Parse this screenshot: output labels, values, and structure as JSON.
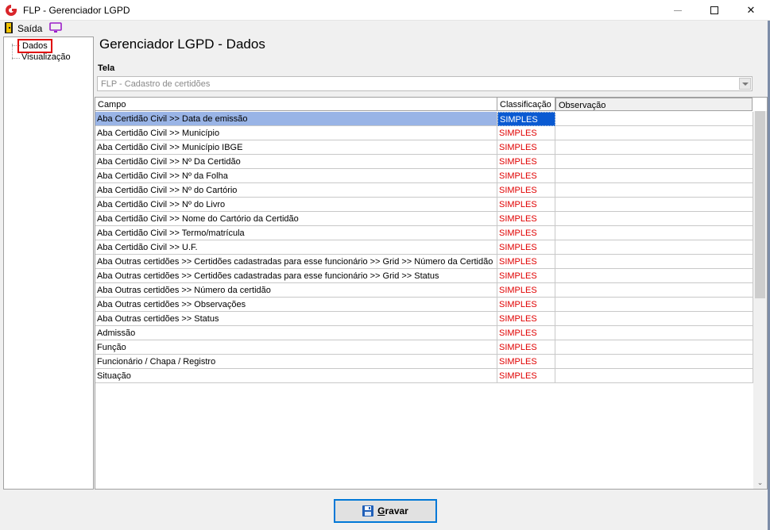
{
  "window": {
    "title": "FLP - Gerenciador LGPD",
    "min_symbol": "",
    "close_symbol": "✕"
  },
  "menu": {
    "exit_label": "Saída"
  },
  "tree": {
    "items": [
      {
        "label": "Dados"
      },
      {
        "label": "Visualização"
      }
    ]
  },
  "main": {
    "page_title": "Gerenciador LGPD - Dados",
    "tela_label": "Tela",
    "tela_value": "FLP - Cadastro de certidões"
  },
  "grid": {
    "columns": [
      "Campo",
      "Classificação",
      "Observação"
    ],
    "rows": [
      {
        "campo": "Aba Certidão Civil >> Data de emissão",
        "classificacao": "SIMPLES",
        "observacao": ""
      },
      {
        "campo": "Aba Certidão Civil >> Município",
        "classificacao": "SIMPLES",
        "observacao": ""
      },
      {
        "campo": "Aba Certidão Civil >> Município IBGE",
        "classificacao": "SIMPLES",
        "observacao": ""
      },
      {
        "campo": "Aba Certidão Civil >> Nº Da Certidão",
        "classificacao": "SIMPLES",
        "observacao": ""
      },
      {
        "campo": "Aba Certidão Civil >> Nº da Folha",
        "classificacao": "SIMPLES",
        "observacao": ""
      },
      {
        "campo": "Aba Certidão Civil >> Nº do Cartório",
        "classificacao": "SIMPLES",
        "observacao": ""
      },
      {
        "campo": "Aba Certidão Civil >> Nº do Livro",
        "classificacao": "SIMPLES",
        "observacao": ""
      },
      {
        "campo": "Aba Certidão Civil >> Nome do Cartório da Certidão",
        "classificacao": "SIMPLES",
        "observacao": ""
      },
      {
        "campo": "Aba Certidão Civil >> Termo/matrícula",
        "classificacao": "SIMPLES",
        "observacao": ""
      },
      {
        "campo": "Aba Certidão Civil >> U.F.",
        "classificacao": "SIMPLES",
        "observacao": ""
      },
      {
        "campo": "Aba Outras certidões >> Certidões cadastradas para esse funcionário >> Grid >> Número da Certidão",
        "classificacao": "SIMPLES",
        "observacao": ""
      },
      {
        "campo": "Aba Outras certidões >> Certidões cadastradas para esse funcionário >> Grid >> Status",
        "classificacao": "SIMPLES",
        "observacao": ""
      },
      {
        "campo": "Aba Outras certidões >> Número da certidão",
        "classificacao": "SIMPLES",
        "observacao": ""
      },
      {
        "campo": "Aba Outras certidões >> Observações",
        "classificacao": "SIMPLES",
        "observacao": ""
      },
      {
        "campo": "Aba Outras certidões >> Status",
        "classificacao": "SIMPLES",
        "observacao": ""
      },
      {
        "campo": "Admissão",
        "classificacao": "SIMPLES",
        "observacao": ""
      },
      {
        "campo": "Função",
        "classificacao": "SIMPLES",
        "observacao": ""
      },
      {
        "campo": "Funcionário / Chapa / Registro",
        "classificacao": "SIMPLES",
        "observacao": ""
      },
      {
        "campo": "Situação",
        "classificacao": "SIMPLES",
        "observacao": ""
      }
    ],
    "selected_row": 0
  },
  "footer": {
    "save_label_underlined": "G",
    "save_label_rest": "ravar"
  },
  "colors": {
    "accent_red": "#e00000",
    "selection_blue": "#99b4e6",
    "selection_cell": "#0a5ad2",
    "button_border": "#0078d7"
  },
  "icons": {
    "app": "flp-logo-icon",
    "exit": "exit-door-icon",
    "monitor": "monitor-icon",
    "save": "floppy-disk-icon",
    "dropdown": "chevron-down-icon"
  }
}
